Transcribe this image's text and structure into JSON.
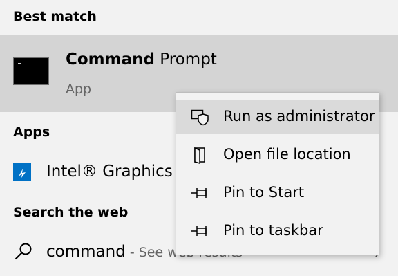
{
  "sections": {
    "best_match": "Best match",
    "apps": "Apps",
    "search_web": "Search the web"
  },
  "best_match": {
    "title_bold": "Command",
    "title_rest": " Prompt",
    "subtitle": "App",
    "icon": "terminal-icon"
  },
  "apps": {
    "items": [
      {
        "label": "Intel® Graphics",
        "icon": "intel-graphics-icon",
        "icon_glyph": "⸝"
      }
    ]
  },
  "search": {
    "query": "command",
    "suffix": " - See web results",
    "icon": "search-icon"
  },
  "context_menu": {
    "items": [
      {
        "label": "Run as administrator",
        "icon": "shield-icon"
      },
      {
        "label": "Open file location",
        "icon": "folder-open-icon"
      },
      {
        "label": "Pin to Start",
        "icon": "pin-icon"
      },
      {
        "label": "Pin to taskbar",
        "icon": "pin-icon"
      }
    ],
    "hovered_index": 0
  },
  "colors": {
    "background": "#f2f2f2",
    "selected_row": "#d4d4d4",
    "menu_hover": "#dadada",
    "intel_blue": "#0071c5"
  }
}
